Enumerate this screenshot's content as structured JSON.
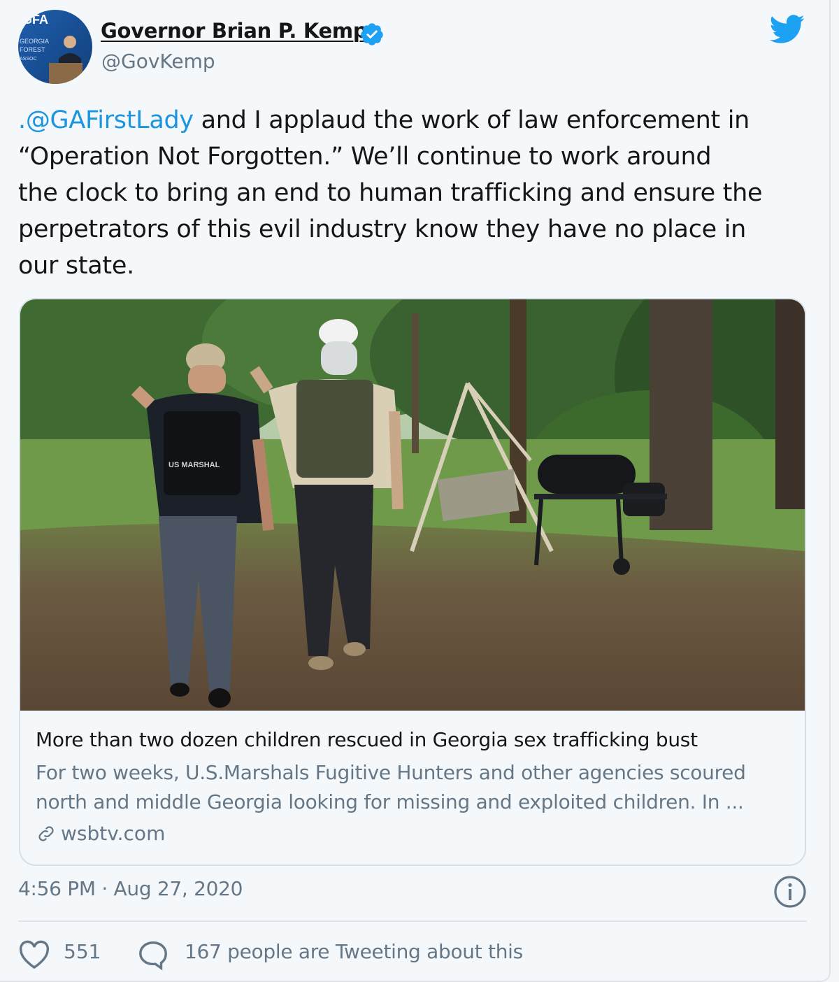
{
  "author": {
    "name": "Governor Brian P. Kemp",
    "handle": "@GovKemp",
    "avatar_text": "GFA GEORGIA FORESTRY ASSOCIATION"
  },
  "tweet": {
    "mention": ".@GAFirstLady",
    "text": " and I applaud the work of law enforcement in\n“Operation Not Forgotten.” We’ll continue to work around\nthe clock to bring an end to human trafficking and ensure the\nperpetrators of this evil industry know they have no place in\nour state."
  },
  "card": {
    "photo_vest_label": "US MARSHAL",
    "title": "More than two dozen children rescued in Georgia sex trafficking bust",
    "description": "For two weeks, U.S.Marshals Fugitive Hunters and other agencies scoured\nnorth and middle Georgia looking for missing and exploited children. In ...",
    "domain": "wsbtv.com"
  },
  "meta": {
    "timestamp": "4:56 PM · Aug 27, 2020"
  },
  "actions": {
    "likes": "551",
    "tweeting": "167 people are Tweeting about this"
  },
  "colors": {
    "accent": "#1da1f2",
    "mention": "#1b95e0",
    "secondary_text": "#657786"
  },
  "icons": [
    "twitter-bird-icon",
    "verified-badge-icon",
    "info-icon",
    "heart-icon",
    "reply-bubble-icon",
    "link-icon"
  ]
}
